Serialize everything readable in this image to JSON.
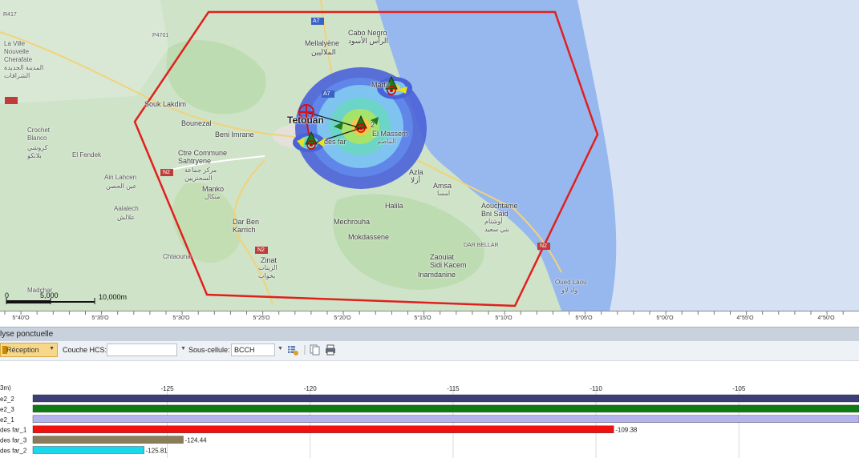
{
  "map": {
    "places": [
      {
        "id": "la-ville-nouvelle",
        "text": "La Ville\nNouvelle\nCherafate"
      },
      {
        "id": "la-ville-nouvelle-ar",
        "text": "المدينة الجديدة\nالشرافات"
      },
      {
        "id": "cabo-negro",
        "text": "Cabo Negro"
      },
      {
        "id": "cabo-negro-ar",
        "text": "الرأس الأسود"
      },
      {
        "id": "mellalyene",
        "text": "Mellalyène"
      },
      {
        "id": "mellalyene-ar",
        "text": "الملاليين"
      },
      {
        "id": "souk-lakdim",
        "text": "Souk Lakdim"
      },
      {
        "id": "bounezal",
        "text": "Bounezal"
      },
      {
        "id": "beni-imrane",
        "text": "Beni Imrane"
      },
      {
        "id": "tetouan",
        "text": "Tetouan"
      },
      {
        "id": "el-massem",
        "text": "El Massem"
      },
      {
        "id": "el-massem-ar",
        "text": "الماصم"
      },
      {
        "id": "crochet-blanco",
        "text": "Crochet\nBlanco"
      },
      {
        "id": "crochet-blanco-ar",
        "text": "كروشي\nبلانكو"
      },
      {
        "id": "el-fendek",
        "text": "El Fendek"
      },
      {
        "id": "ctre-commune",
        "text": "Ctre Commune\nSahtryene"
      },
      {
        "id": "ctre-commune-ar",
        "text": "مركز جماعة\nالسحتريين"
      },
      {
        "id": "manko",
        "text": "Manko"
      },
      {
        "id": "manko-ar",
        "text": "منكال"
      },
      {
        "id": "ain-lahcen",
        "text": "Ain Lahcen"
      },
      {
        "id": "ain-lahcen-ar",
        "text": "عين الحصن"
      },
      {
        "id": "aalalech",
        "text": "Aalalech"
      },
      {
        "id": "aalalech-ar",
        "text": "علالش"
      },
      {
        "id": "azla",
        "text": "Azla"
      },
      {
        "id": "azla-ar",
        "text": "أزلا"
      },
      {
        "id": "amsa",
        "text": "Amsa"
      },
      {
        "id": "amsa-ar",
        "text": "امسا"
      },
      {
        "id": "halila",
        "text": "Halila"
      },
      {
        "id": "aouchtame",
        "text": "Aouchtame\nBni Said"
      },
      {
        "id": "aouchtame-ar",
        "text": "أوشتام\nبني سعيد"
      },
      {
        "id": "dar-ben-karrich",
        "text": "Dar Ben\nKarrich"
      },
      {
        "id": "mechrouha",
        "text": "Mechrouha"
      },
      {
        "id": "mokdassene",
        "text": "Mokdassene"
      },
      {
        "id": "dar-bellar",
        "text": "DAR BELLAR"
      },
      {
        "id": "chtaouna",
        "text": "Chtaouna"
      },
      {
        "id": "zinat",
        "text": "Zinat"
      },
      {
        "id": "zinat-ar",
        "text": "الزينات\nبخواب"
      },
      {
        "id": "zaouiat",
        "text": "Zaouiat\nSidi Kacem"
      },
      {
        "id": "inamdanine",
        "text": "Inamdanine"
      },
      {
        "id": "madchar",
        "text": "Madchar"
      },
      {
        "id": "oued-laou",
        "text": "Oued Laou"
      },
      {
        "id": "oued-laou-ar",
        "text": "واد لاو"
      },
      {
        "id": "martil",
        "text": "Martil"
      },
      {
        "id": "des-far",
        "text": "des far"
      },
      {
        "id": "site2",
        "text": "2"
      }
    ],
    "road_labels": [
      "A7",
      "A7",
      "N2",
      "N2",
      "N2",
      "R417",
      "P4701"
    ],
    "scale": {
      "zero": "0",
      "mid": "5,000",
      "end": "10,000m"
    },
    "colors": {
      "sea": "#97b8ef",
      "land": "#cfe3c8",
      "boundary": "#e0201e",
      "coverage_outer": "#3d5dd4"
    }
  },
  "ruler": {
    "ticks": [
      "5°40'O",
      "5°35'O",
      "5°30'O",
      "5°25'O",
      "5°20'O",
      "5°15'O",
      "5°10'O",
      "5°05'O",
      "5°00'O",
      "4°55'O",
      "4°50'O"
    ]
  },
  "panel": {
    "title": "lyse ponctuelle",
    "toolbar": {
      "reception_label": "Réception",
      "couche_label": "Couche HCS:",
      "couche_value": "",
      "sous_cellule_label": "Sous-cellule:",
      "sous_cellule_value": "BCCH"
    }
  },
  "chart_data": {
    "type": "bar",
    "unit_label": "3m)",
    "xlim": [
      -129.7,
      -100.8
    ],
    "x_ticks": [
      -125,
      -120,
      -115,
      -110,
      -105
    ],
    "categories": [
      "e2_2",
      "e2_3",
      "e2_1",
      "des far_1",
      "des far_3",
      "des far_2"
    ],
    "values": [
      -100.8,
      -100.8,
      -100.8,
      -109.38,
      -124.44,
      -125.81
    ],
    "value_labels": [
      "",
      "",
      "",
      "-109.38",
      "-124.44",
      "-125.81"
    ],
    "colors": [
      "#3c3e78",
      "#0e7a16",
      "#b5b3ee",
      "#f01010",
      "#8b7d5a",
      "#17d9eb"
    ]
  }
}
